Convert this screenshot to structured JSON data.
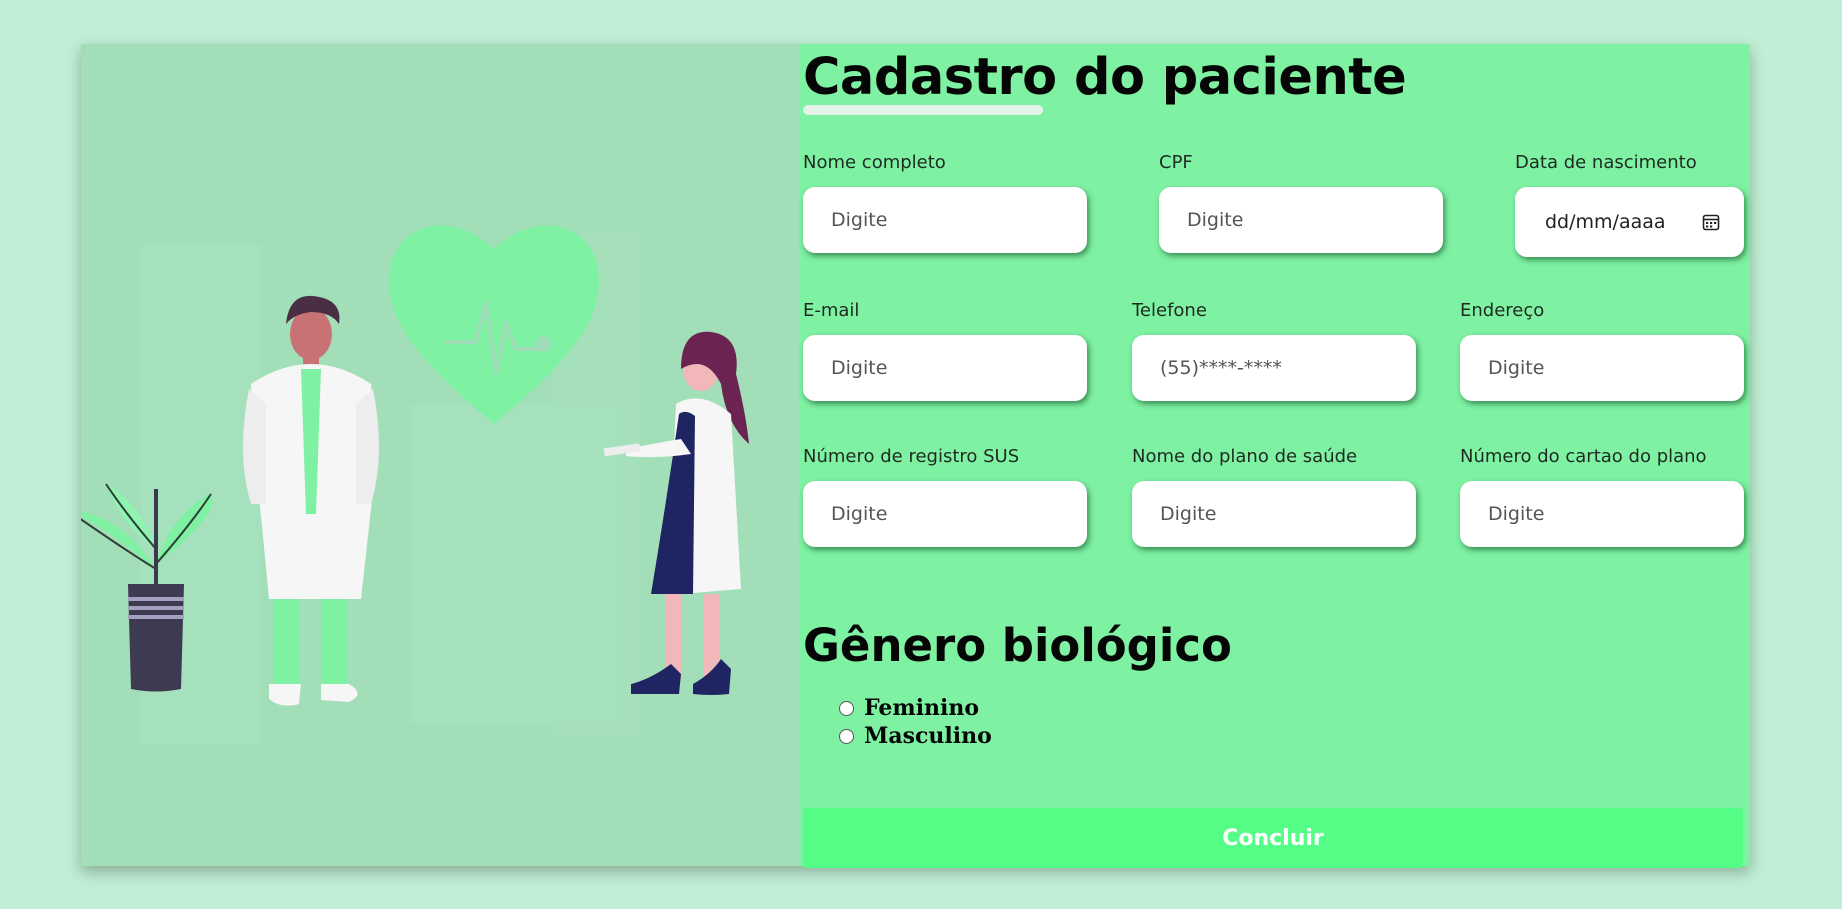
{
  "form": {
    "title": "Cadastro do paciente",
    "fields": [
      {
        "label": "Nome completo",
        "placeholder": "Digite"
      },
      {
        "label": "CPF",
        "placeholder": "Digite"
      },
      {
        "label": "Data de nascimento",
        "placeholder": "dd/mm/aaaa"
      },
      {
        "label": "E-mail",
        "placeholder": "Digite"
      },
      {
        "label": "Telefone",
        "placeholder": "(55)****-****"
      },
      {
        "label": "Endereço",
        "placeholder": "Digite"
      },
      {
        "label": "Número de registro SUS",
        "placeholder": "Digite"
      },
      {
        "label": "Nome do plano de saúde",
        "placeholder": "Digite"
      },
      {
        "label": "Número do cartao do plano",
        "placeholder": "Digite"
      }
    ],
    "gender_title": "Gênero biológico",
    "gender_options": [
      "Feminino",
      "Masculino"
    ],
    "submit_label": "Concluir"
  },
  "colors": {
    "page_bg": "#c0efd5",
    "form_bg": "#7ef1a3",
    "illustration_bg": "#a2dfb8",
    "submit_bg": "#53fd86"
  },
  "illustration": {
    "icons": [
      "heart-pulse-icon",
      "male-doctor-illustration",
      "female-doctor-illustration",
      "potted-plant-illustration"
    ]
  }
}
